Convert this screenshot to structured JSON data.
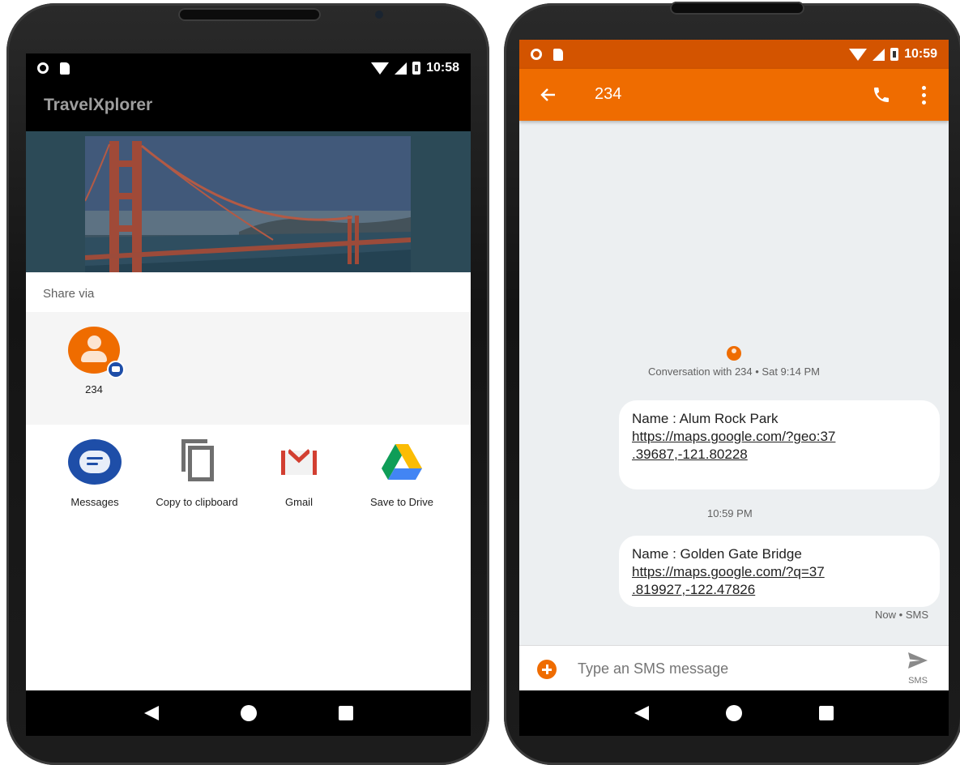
{
  "left_phone": {
    "status": {
      "time": "10:58"
    },
    "app_title": "TravelXplorer",
    "share": {
      "title": "Share via",
      "contact": {
        "name": "234"
      },
      "apps": [
        {
          "label": "Messages"
        },
        {
          "label": "Copy to clipboard"
        },
        {
          "label": "Gmail"
        },
        {
          "label": "Save to Drive"
        }
      ]
    }
  },
  "right_phone": {
    "status": {
      "time": "10:59"
    },
    "toolbar": {
      "title": "234"
    },
    "conversation_meta": "Conversation with 234 • Sat 9:14 PM",
    "messages": [
      {
        "name": "Name : Alum Rock Park",
        "link_line1": "https://maps.google.com/?geo:37",
        "link_line2": ".39687,-121.80228"
      },
      {
        "name": "Name : Golden Gate Bridge",
        "link_line1": "https://maps.google.com/?q=37",
        "link_line2": ".819927,-122.47826"
      }
    ],
    "time_separator": "10:59 PM",
    "message_status": "Now • SMS",
    "composer": {
      "placeholder": "Type an SMS message",
      "send_label": "SMS"
    }
  },
  "colors": {
    "accent": "#ef6c00",
    "status_bar": "#d35400",
    "messages_blue": "#1e4ea8"
  }
}
